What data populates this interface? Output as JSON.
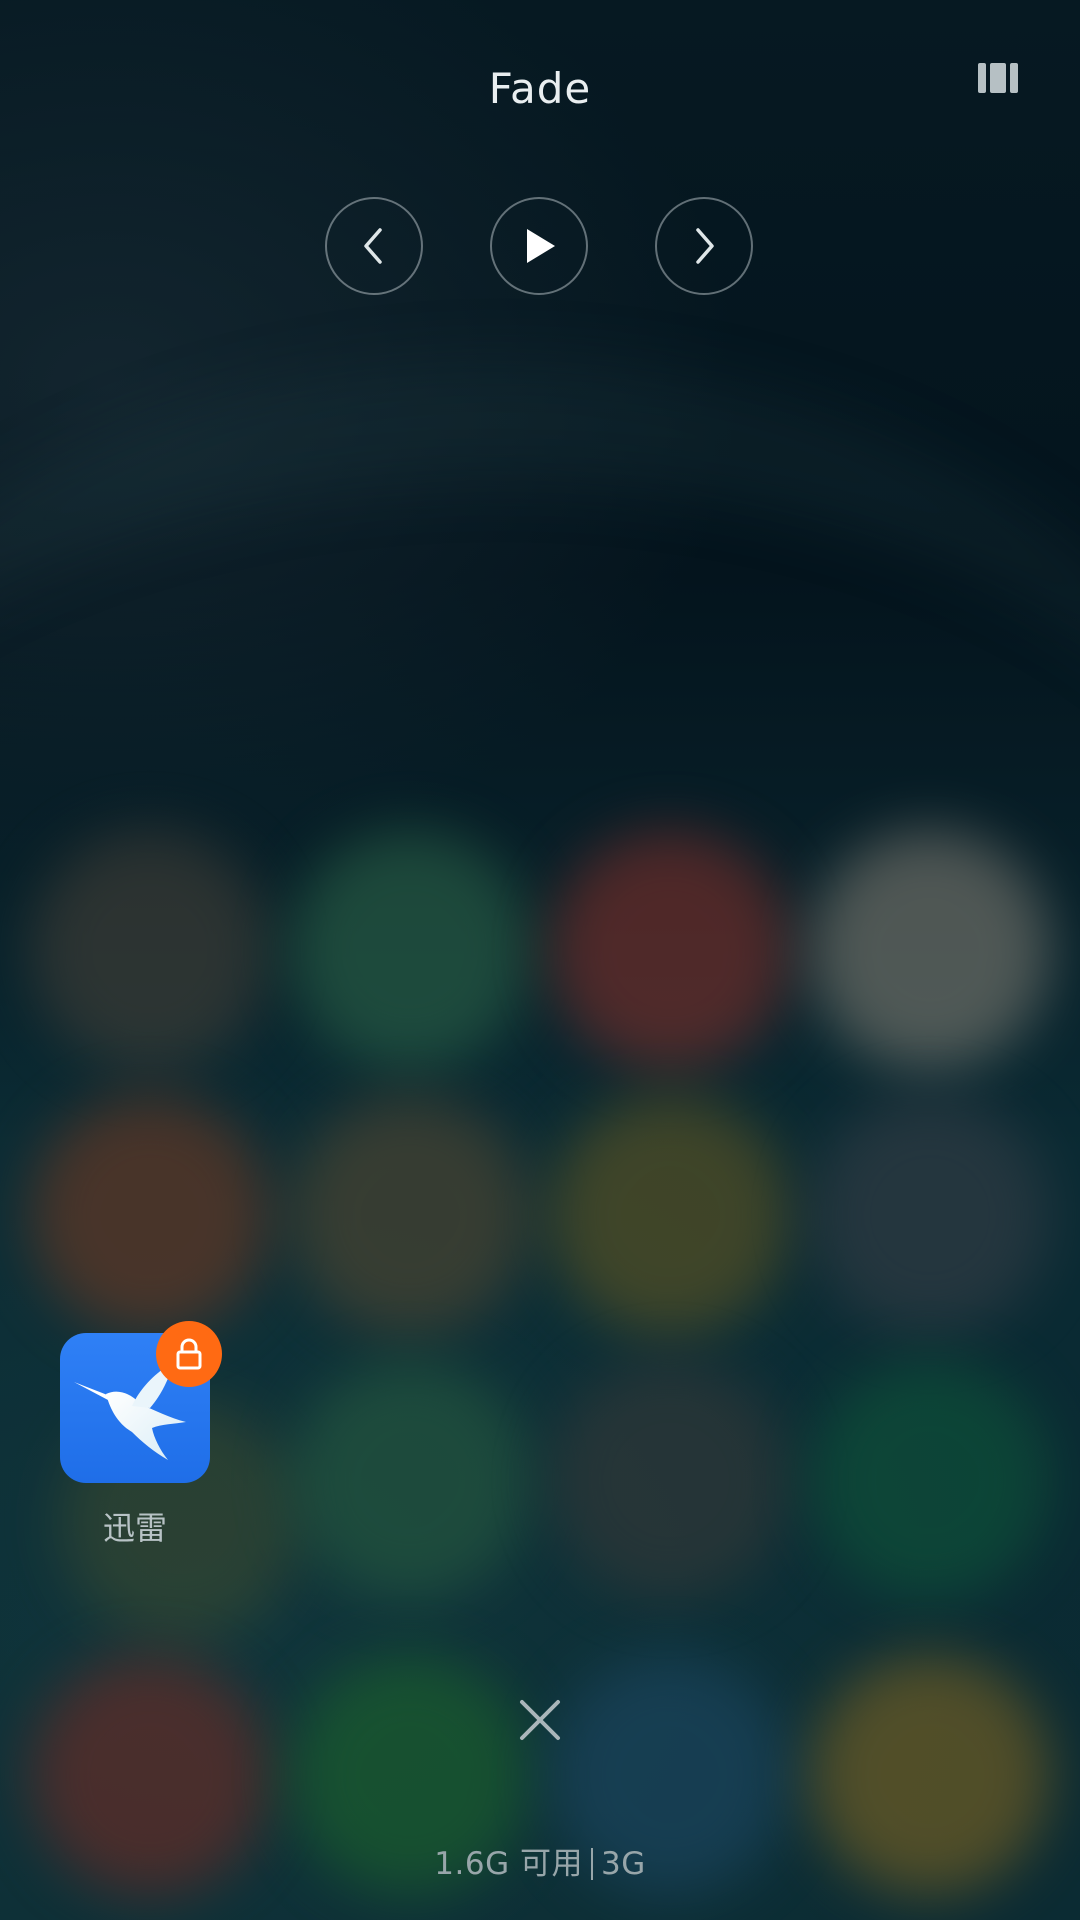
{
  "music_widget": {
    "track_title": "Fade",
    "menu_icon": "bars-icon",
    "controls": [
      {
        "name": "previous",
        "icon": "chevron-left-icon"
      },
      {
        "name": "play",
        "icon": "play-icon"
      },
      {
        "name": "next",
        "icon": "chevron-right-icon"
      }
    ]
  },
  "recent_apps": [
    {
      "label": "迅雷",
      "icon": "hummingbird-icon",
      "locked": true,
      "badge_icon": "lock-icon"
    }
  ],
  "footer": {
    "close_icon": "close-icon",
    "memory_available": "1.6G 可用",
    "memory_total": "3G"
  },
  "colors": {
    "app_blue": "#2f80f6",
    "lock_orange": "#ff6a13"
  }
}
